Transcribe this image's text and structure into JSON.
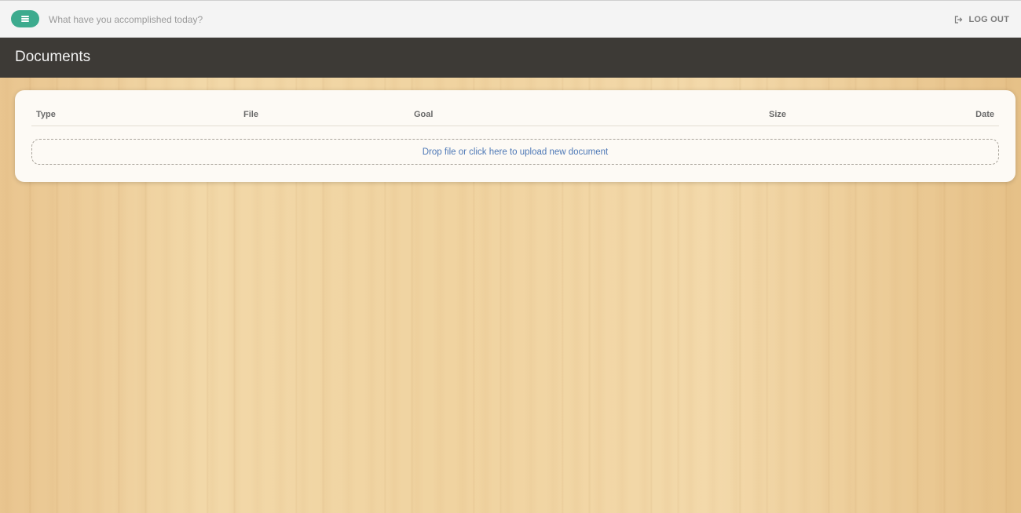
{
  "topbar": {
    "menu_icon": "hamburger-icon",
    "goal_placeholder": "What have you accomplished today?",
    "logout_icon": "sign-out-icon",
    "logout_label": "LOG OUT"
  },
  "header": {
    "title": "Documents"
  },
  "documents_table": {
    "columns": [
      "Type",
      "File",
      "Goal",
      "Size",
      "Date"
    ],
    "rows": [],
    "dropzone_text": "Drop file or click here to upload new document"
  },
  "colors": {
    "accent": "#3dab8e",
    "header_bg": "#3d3a36",
    "link": "#4d78b6"
  }
}
